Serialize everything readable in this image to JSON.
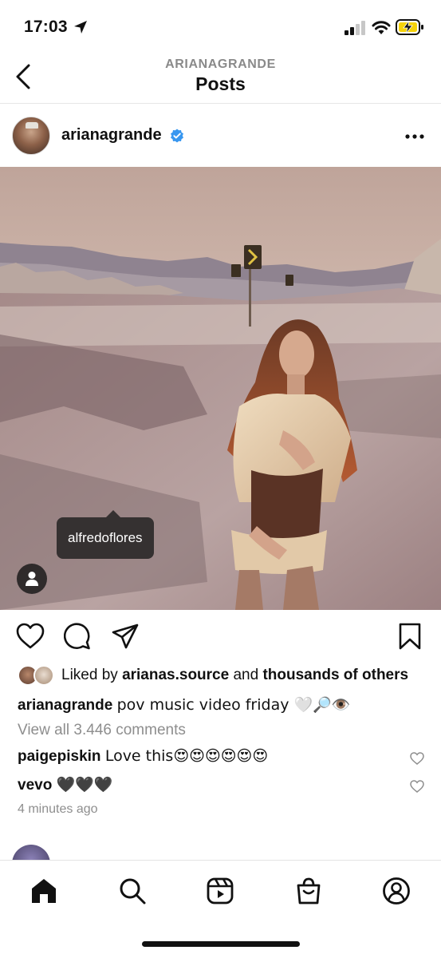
{
  "status_bar": {
    "time": "17:03",
    "icons": [
      "location-arrow-icon",
      "cellular-signal-icon",
      "wifi-icon",
      "battery-charging-icon"
    ]
  },
  "header": {
    "subtitle": "ARIANAGRANDE",
    "title": "Posts",
    "back_icon": "chevron-left-icon"
  },
  "post": {
    "username": "arianagrande",
    "verified": true,
    "more_icon": "ellipsis-icon",
    "tag": "alfredoflores",
    "liked_by_prefix": "Liked by",
    "liked_by_user": "arianas.source",
    "liked_by_joiner": "and",
    "liked_by_others": "thousands of others",
    "caption_user": "arianagrande",
    "caption_text": "pov music video friday 🤍🔎👁️",
    "view_comments": "View all 3.446 comments",
    "comments": [
      {
        "user": "paigepiskin",
        "text": "Love this😍😍😍😍😍😍"
      },
      {
        "user": "vevo",
        "text": "🖤🖤🖤"
      }
    ],
    "time_ago": "4 minutes ago"
  },
  "tab_bar": {
    "items": [
      "home-icon",
      "search-icon",
      "reels-icon",
      "shop-icon",
      "profile-icon"
    ],
    "active": "home-icon"
  },
  "colors": {
    "verified_blue": "#3897f0",
    "text_primary": "#111111",
    "text_secondary": "#8e8e8e",
    "photo_sky": "#d9c3b6",
    "photo_road": "#a88f8f"
  }
}
